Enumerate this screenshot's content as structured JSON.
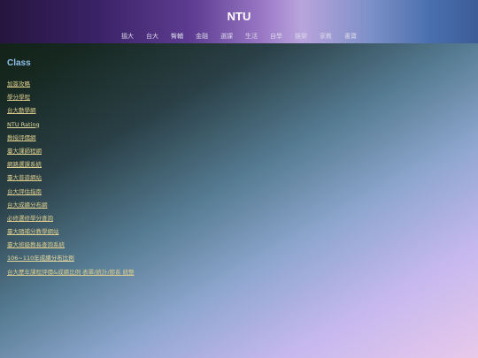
{
  "header": {
    "title": "NTU",
    "nav": [
      "搵大",
      "台大",
      "臀輔",
      "金融",
      "選課",
      "生活",
      "自學",
      "娛樂",
      "家教",
      "書寶"
    ]
  },
  "main": {
    "section_title": "Class",
    "links": [
      "加簽攻略",
      "學分學程",
      "台大動學網",
      "NTU Rating",
      "教授評價網",
      "臺大課師程網",
      "網路選課系統",
      "臺大普遊網站",
      "台大評估指南",
      "台大成績分布網",
      "必修選修學分查詢",
      "臺大隨補分教學網站",
      "臺大班級教長查詢系統",
      "106~110年成績分布比例",
      "台大歷年課程評價&成績比例 表單/統計/節系 統整"
    ]
  }
}
